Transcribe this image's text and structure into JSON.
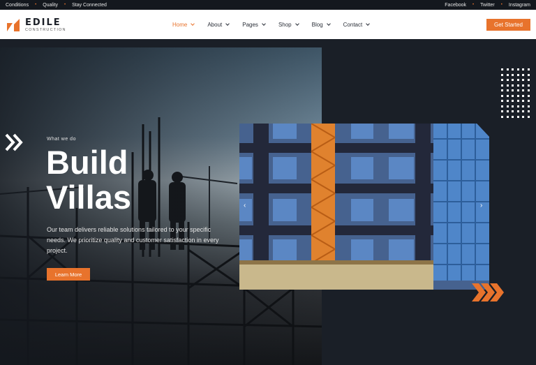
{
  "topbar": {
    "left_links": [
      "Conditions",
      "Quality",
      "Stay Connected"
    ],
    "right_links": [
      "Facebook",
      "Twitter",
      "Instagram"
    ]
  },
  "header": {
    "logo": {
      "name": "EDILE",
      "tagline": "CONSTRUCTION"
    },
    "nav": [
      {
        "label": "Home",
        "active": true
      },
      {
        "label": "About"
      },
      {
        "label": "Pages"
      },
      {
        "label": "Shop"
      },
      {
        "label": "Blog"
      },
      {
        "label": "Contact"
      }
    ],
    "cta_label": "Get Started"
  },
  "hero": {
    "kicker": "What we do",
    "headline_line1": "Build",
    "headline_line2": "Villas",
    "description": "Our team delivers reliable solutions tailored to your specific needs. We prioritize quality and customer satisfaction in every project.",
    "button_label": "Learn More"
  },
  "slider": {
    "prev_icon": "chevron-left-icon",
    "next_icon": "chevron-right-icon"
  },
  "colors": {
    "accent": "#e8732c",
    "dark_bg": "#1a1f27",
    "topbar_bg": "#14181e",
    "header_bg": "#ffffff"
  }
}
